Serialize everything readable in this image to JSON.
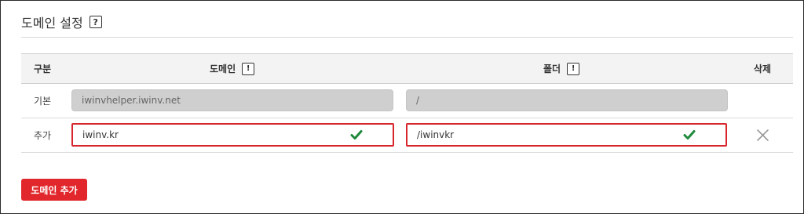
{
  "section": {
    "title": "도메인 설정",
    "help_glyph": "?"
  },
  "table": {
    "headers": {
      "type": "구분",
      "domain": "도메인",
      "folder": "폴더",
      "delete": "삭제"
    },
    "info_glyph": "!",
    "rows": [
      {
        "type": "기본",
        "domain": "iwinvhelper.iwinv.net",
        "folder": "/"
      },
      {
        "type": "추가",
        "domain": "iwinv.kr",
        "folder": "/iwinvkr"
      }
    ]
  },
  "actions": {
    "add_domain_label": "도메인 추가"
  },
  "colors": {
    "accent_red": "#e1272b",
    "valid_green": "#1e8a3c"
  }
}
